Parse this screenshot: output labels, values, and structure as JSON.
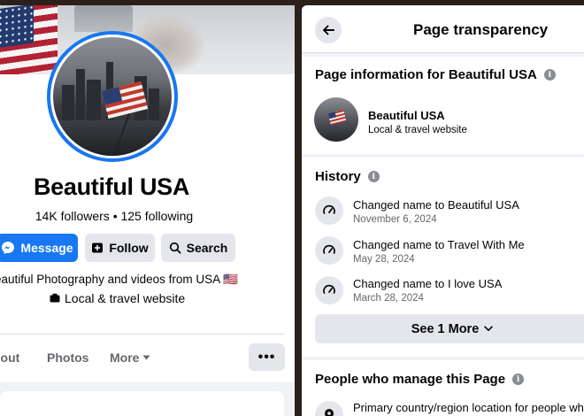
{
  "profile": {
    "name": "Beautiful USA",
    "followers_text": "14K followers • 125 following",
    "bio": "eautiful Photography and videos from USA 🇺🇸",
    "category": "Local & travel website"
  },
  "actions": {
    "message_label": "Message",
    "follow_label": "Follow",
    "search_label": "Search"
  },
  "tabs": [
    {
      "label": "bout"
    },
    {
      "label": "Photos"
    },
    {
      "label": "More"
    }
  ],
  "more_options_label": "•••",
  "transparency": {
    "title": "Page transparency",
    "page_info_title": "Page information for Beautiful USA",
    "page_name": "Beautiful USA",
    "page_category": "Local & travel website",
    "history_title": "History",
    "history": [
      {
        "title": "Changed name to Beautiful USA",
        "date": "November 6, 2024"
      },
      {
        "title": "Changed name to Travel With Me",
        "date": "May 28, 2024"
      },
      {
        "title": "Changed name to I love USA",
        "date": "March 28, 2024"
      }
    ],
    "see_more_label": "See 1 More",
    "people_title": "People who manage this Page",
    "people_line": "Primary country/region location for people wh"
  },
  "colors": {
    "accent": "#1877f2",
    "button_gray": "#e4e6eb",
    "secondary_text": "#65676b",
    "panel_bg": "#f0f2f5"
  },
  "icons": {
    "messenger": "messenger-icon",
    "follow": "follow-plus-icon",
    "search": "search-icon",
    "category": "category-icon",
    "more_caret": "caret-down-icon",
    "back": "arrow-left-icon",
    "info": "info-icon",
    "history": "speedometer-icon",
    "chevron": "chevron-down-icon",
    "location": "location-pin-icon"
  }
}
